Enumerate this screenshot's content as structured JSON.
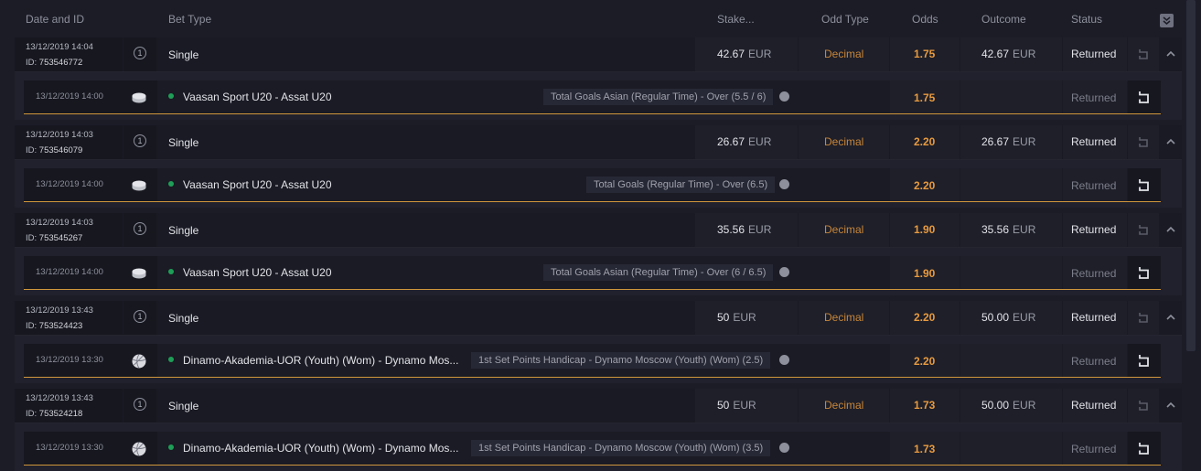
{
  "header": {
    "date_id": "Date and ID",
    "bet_type": "Bet Type",
    "stake": "Stake...",
    "odd_type": "Odd Type",
    "odds": "Odds",
    "outcome": "Outcome",
    "status": "Status"
  },
  "colors": {
    "accent": "#e89a3e",
    "odd_type": "#c8863a",
    "live_dot": "#1e9e57",
    "underline": "#d0963c"
  },
  "bets": [
    {
      "date": "13/12/2019 14:04",
      "id_label": "ID:",
      "id": "753546772",
      "num": "1",
      "type": "Single",
      "stake": "42.67",
      "currency": "EUR",
      "odd_type": "Decimal",
      "odds": "1.75",
      "outcome": "42.67",
      "outcome_currency": "EUR",
      "status": "Returned",
      "selection": {
        "date": "13/12/2019 14:00",
        "sport_icon": "hockey-puck-icon",
        "event": "Vaasan Sport U20 - Assat U20",
        "market": "Total Goals Asian (Regular Time) - Over (5.5 / 6)",
        "odds": "1.75",
        "status": "Returned"
      }
    },
    {
      "date": "13/12/2019 14:03",
      "id_label": "ID:",
      "id": "753546079",
      "num": "1",
      "type": "Single",
      "stake": "26.67",
      "currency": "EUR",
      "odd_type": "Decimal",
      "odds": "2.20",
      "outcome": "26.67",
      "outcome_currency": "EUR",
      "status": "Returned",
      "selection": {
        "date": "13/12/2019 14:00",
        "sport_icon": "hockey-puck-icon",
        "event": "Vaasan Sport U20 - Assat U20",
        "market": "Total Goals (Regular Time) - Over (6.5)",
        "odds": "2.20",
        "status": "Returned"
      }
    },
    {
      "date": "13/12/2019 14:03",
      "id_label": "ID:",
      "id": "753545267",
      "num": "1",
      "type": "Single",
      "stake": "35.56",
      "currency": "EUR",
      "odd_type": "Decimal",
      "odds": "1.90",
      "outcome": "35.56",
      "outcome_currency": "EUR",
      "status": "Returned",
      "selection": {
        "date": "13/12/2019 14:00",
        "sport_icon": "hockey-puck-icon",
        "event": "Vaasan Sport U20 - Assat U20",
        "market": "Total Goals Asian (Regular Time) - Over (6 / 6.5)",
        "odds": "1.90",
        "status": "Returned"
      }
    },
    {
      "date": "13/12/2019 13:43",
      "id_label": "ID:",
      "id": "753524423",
      "num": "1",
      "type": "Single",
      "stake": "50",
      "currency": "EUR",
      "odd_type": "Decimal",
      "odds": "2.20",
      "outcome": "50.00",
      "outcome_currency": "EUR",
      "status": "Returned",
      "selection": {
        "date": "13/12/2019 13:30",
        "sport_icon": "volleyball-icon",
        "event": "Dinamo-Akademia-UOR (Youth) (Wom) - Dynamo Mos...",
        "market": "1st Set Points Handicap - Dynamo Moscow (Youth) (Wom) (2.5)",
        "odds": "2.20",
        "status": "Returned"
      }
    },
    {
      "date": "13/12/2019 13:43",
      "id_label": "ID:",
      "id": "753524218",
      "num": "1",
      "type": "Single",
      "stake": "50",
      "currency": "EUR",
      "odd_type": "Decimal",
      "odds": "1.73",
      "outcome": "50.00",
      "outcome_currency": "EUR",
      "status": "Returned",
      "selection": {
        "date": "13/12/2019 13:30",
        "sport_icon": "volleyball-icon",
        "event": "Dinamo-Akademia-UOR (Youth) (Wom) - Dynamo Mos...",
        "market": "1st Set Points Handicap - Dynamo Moscow (Youth) (Wom) (3.5)",
        "odds": "1.73",
        "status": "Returned"
      }
    }
  ]
}
